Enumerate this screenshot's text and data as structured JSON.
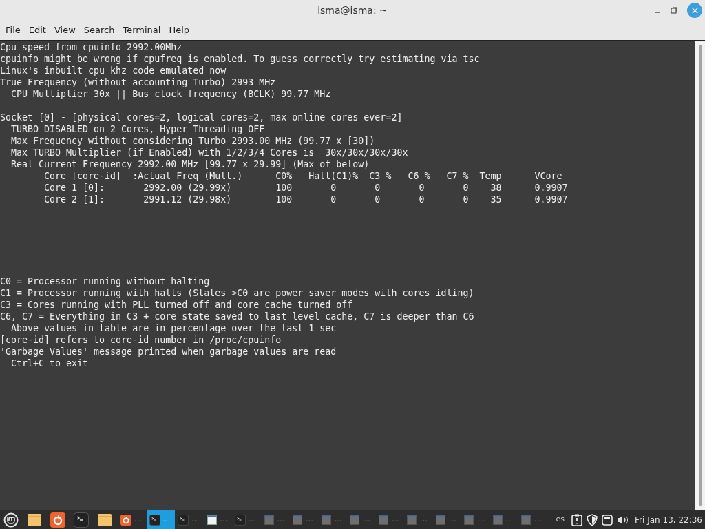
{
  "window": {
    "title": "isma@isma: ~"
  },
  "menu": [
    "File",
    "Edit",
    "View",
    "Search",
    "Terminal",
    "Help"
  ],
  "terminal": {
    "blocks": [
      [
        "Cpu speed from cpuinfo 2992.00Mhz",
        "cpuinfo might be wrong if cpufreq is enabled. To guess correctly try estimating via tsc",
        "Linux's inbuilt cpu_khz code emulated now",
        "True Frequency (without accounting Turbo) 2993 MHz",
        "  CPU Multiplier 30x || Bus clock frequency (BCLK) 99.77 MHz"
      ],
      [
        "Socket [0] - [physical cores=2, logical cores=2, max online cores ever=2]",
        "  TURBO DISABLED on 2 Cores, Hyper Threading OFF",
        "  Max Frequency without considering Turbo 2993.00 MHz (99.77 x [30])",
        "  Max TURBO Multiplier (if Enabled) with 1/2/3/4 Cores is  30x/30x/30x/30x",
        "  Real Current Frequency 2992.00 MHz [99.77 x 29.99] (Max of below)",
        "        Core [core-id]  :Actual Freq (Mult.)      C0%   Halt(C1)%  C3 %   C6 %   C7 %  Temp      VCore",
        "        Core 1 [0]:       2992.00 (29.99x)        100       0       0       0       0    38      0.9907",
        "        Core 2 [1]:       2991.12 (29.98x)        100       0       0       0       0    35      0.9907"
      ],
      [
        "C0 = Processor running without halting",
        "C1 = Processor running with halts (States >C0 are power saver modes with cores idling)",
        "C3 = Cores running with PLL turned off and core cache turned off",
        "C6, C7 = Everything in C3 + core state saved to last level cache, C7 is deeper than C6",
        "  Above values in table are in percentage over the last 1 sec",
        "[core-id] refers to core-id number in /proc/cpuinfo",
        "'Garbage Values' message printed when garbage values are read",
        "  Ctrl+C to exit"
      ]
    ]
  },
  "taskbar": {
    "launchers": [
      {
        "kind": "menu"
      },
      {
        "kind": "folder"
      },
      {
        "kind": "browser"
      },
      {
        "kind": "terminal"
      },
      {
        "kind": "folder"
      }
    ],
    "windows": [
      {
        "kind": "browser",
        "label": "…",
        "selected": false
      },
      {
        "kind": "terminal",
        "label": "…",
        "selected": true
      },
      {
        "kind": "terminal",
        "label": "…",
        "selected": false
      },
      {
        "kind": "window",
        "label": "…",
        "selected": false
      },
      {
        "kind": "terminal",
        "label": "…",
        "selected": false
      },
      {
        "kind": "app",
        "label": "…",
        "selected": false
      },
      {
        "kind": "app",
        "label": "…",
        "selected": false
      },
      {
        "kind": "app",
        "label": "…",
        "selected": false
      },
      {
        "kind": "app",
        "label": "…",
        "selected": false
      },
      {
        "kind": "app",
        "label": "…",
        "selected": false
      },
      {
        "kind": "app",
        "label": "…",
        "selected": false
      },
      {
        "kind": "app",
        "label": "…",
        "selected": false
      },
      {
        "kind": "app",
        "label": "…",
        "selected": false
      },
      {
        "kind": "app",
        "label": "…",
        "selected": false
      },
      {
        "kind": "app",
        "label": "…",
        "selected": false
      }
    ],
    "keyboard": "es",
    "clock": "Fri Jan 13, 22:36"
  }
}
